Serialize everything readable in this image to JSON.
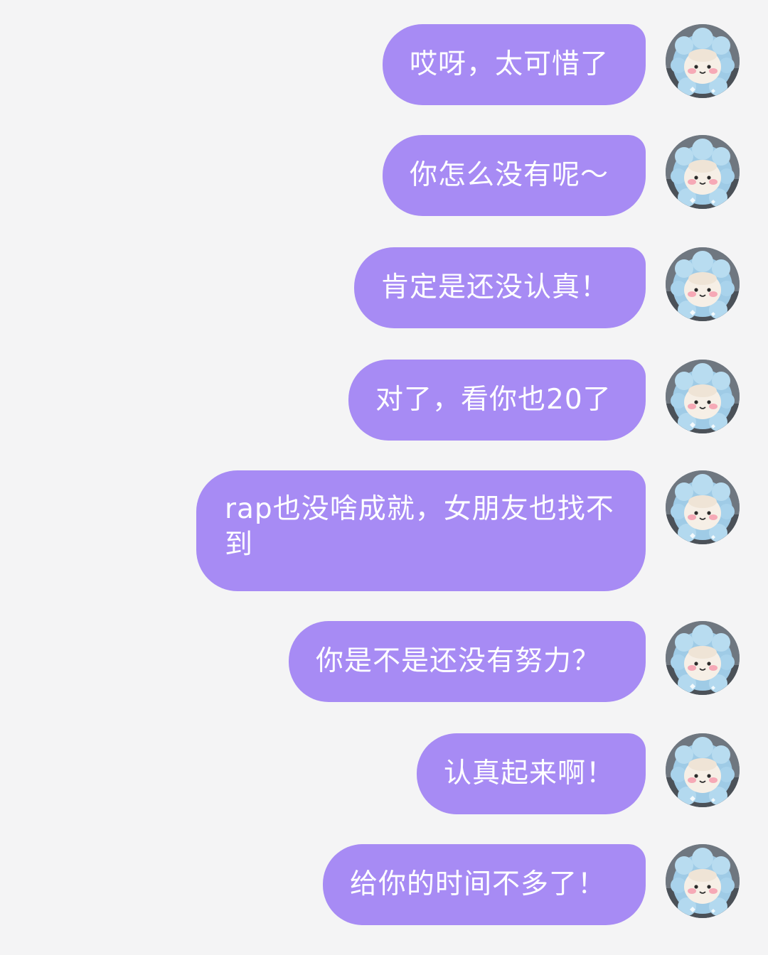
{
  "colors": {
    "background": "#f4f4f5",
    "bubble": "#a78bf4",
    "bubble_text": "#ffffff"
  },
  "avatar_icon": "plush-toy-avatar-icon",
  "messages": [
    {
      "text": "哎呀，太可惜了"
    },
    {
      "text": "你怎么没有呢～"
    },
    {
      "text": "肯定是还没认真！"
    },
    {
      "text": "对了，看你也20了"
    },
    {
      "text": "rap也没啥成就，女朋友也找不到"
    },
    {
      "text": "你是不是还没有努力？"
    },
    {
      "text": "认真起来啊！"
    },
    {
      "text": "给你的时间不多了！"
    }
  ]
}
